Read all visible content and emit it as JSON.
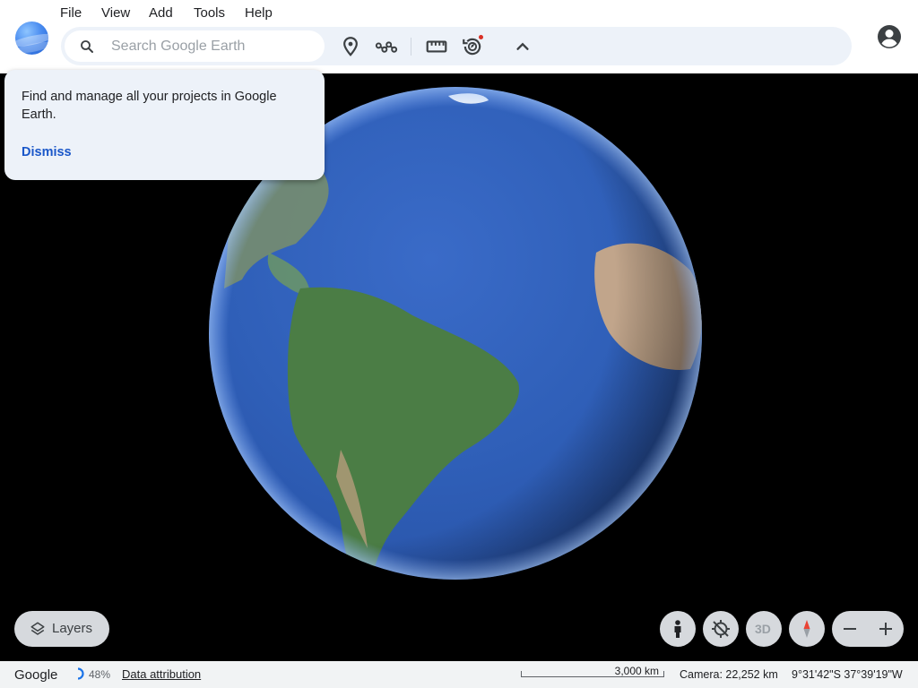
{
  "menu": {
    "items": [
      "File",
      "View",
      "Add",
      "Tools",
      "Help"
    ]
  },
  "search": {
    "placeholder": "Search Google Earth",
    "value": ""
  },
  "toolbar": {
    "icons": [
      "search-icon",
      "place-marker-icon",
      "path-icon",
      "ruler-icon",
      "voyager-icon",
      "chevron-up-icon"
    ]
  },
  "promo_card": {
    "text": "Find and manage all your projects in Google Earth.",
    "dismiss_label": "Dismiss"
  },
  "controls": {
    "layers_label": "Layers",
    "three_d_label": "3D"
  },
  "status": {
    "provider": "Google",
    "loading_percent": "48%",
    "attribution_label": "Data attribution",
    "scale_label": "3,000 km",
    "camera": "Camera: 22,252 km",
    "coordinates": "9°31'42\"S 37°39'19\"W"
  },
  "colors": {
    "toolbar_bg": "#edf2f9",
    "accent_link": "#1a57c9",
    "notification_dot": "#d93025",
    "ocean": "#2f5fb8",
    "land": "#3f7a3a"
  }
}
